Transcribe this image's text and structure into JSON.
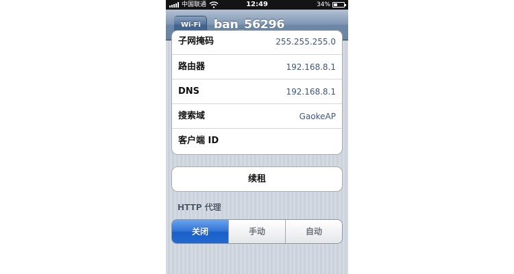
{
  "status_bar": {
    "carrier": "中国联通",
    "time": "12:49",
    "battery_percent_label": "34%",
    "battery_level": 0.34
  },
  "nav": {
    "back_label": "Wi-Fi",
    "title": "ban_56296"
  },
  "details": [
    {
      "label": "子网掩码",
      "value": "255.255.255.0"
    },
    {
      "label": "路由器",
      "value": "192.168.8.1"
    },
    {
      "label": "DNS",
      "value": "192.168.8.1"
    },
    {
      "label": "搜索域",
      "value": "GaokeAP"
    },
    {
      "label": "客户端 ID",
      "value": ""
    }
  ],
  "renew_label": "续租",
  "proxy": {
    "header": "HTTP 代理",
    "options": [
      "关闭",
      "手动",
      "自动"
    ],
    "selected": "关闭"
  },
  "colors": {
    "selected_segment": "#2f73d6",
    "value_text": "#3b557d",
    "nav_bar": "#6d87a6"
  }
}
